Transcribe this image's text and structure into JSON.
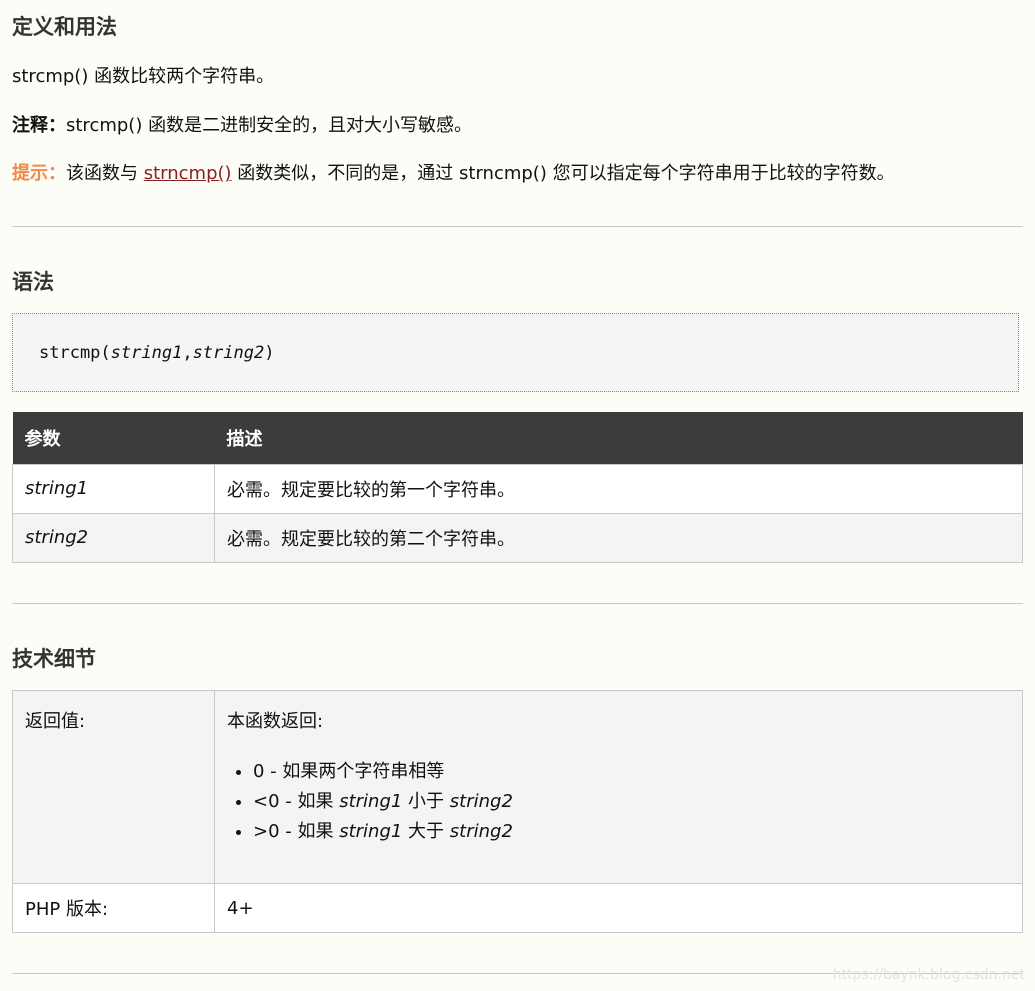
{
  "definition": {
    "title": "定义和用法",
    "desc": "strcmp() 函数比较两个字符串。",
    "note_label": "注释：",
    "note_text": "strcmp() 函数是二进制安全的，且对大小写敏感。",
    "tip_label": "提示：",
    "tip_before": "该函数与 ",
    "tip_link": "strncmp()",
    "tip_after": " 函数类似，不同的是，通过 strncmp() 您可以指定每个字符串用于比较的字符数。"
  },
  "syntax": {
    "title": "语法",
    "func": "strcmp(",
    "arg1": "string1",
    "comma": ",",
    "arg2": "string2",
    "close": ")"
  },
  "params_table": {
    "headers": [
      "参数",
      "描述"
    ],
    "rows": [
      {
        "name": "string1",
        "desc": "必需。规定要比较的第一个字符串。"
      },
      {
        "name": "string2",
        "desc": "必需。规定要比较的第二个字符串。"
      }
    ]
  },
  "tech": {
    "title": "技术细节",
    "return_label": "返回值:",
    "return_intro": "本函数返回:",
    "return_items": [
      {
        "pre": "0 - 如果两个字符串相等",
        "a": "",
        "mid": "",
        "b": ""
      },
      {
        "pre": "<0 - 如果 ",
        "a": "string1",
        "mid": " 小于 ",
        "b": "string2"
      },
      {
        "pre": ">0 - 如果 ",
        "a": "string1",
        "mid": " 大于 ",
        "b": "string2"
      }
    ],
    "version_label": "PHP 版本:",
    "version_value": "4+"
  },
  "watermark": "https://baynk.blog.csdn.net"
}
